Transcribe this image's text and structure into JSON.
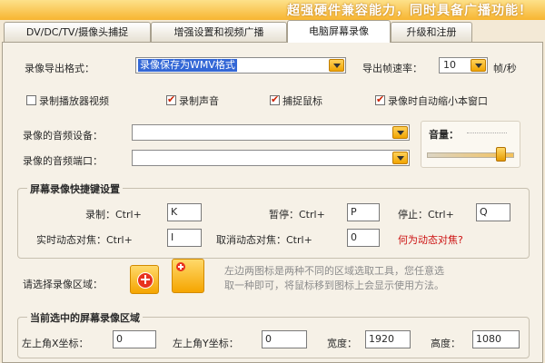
{
  "banner": {
    "text": "超强硬件兼容能力，同时具备广播功能！"
  },
  "tabs": [
    {
      "label": "DV/DC/TV/摄像头捕捉"
    },
    {
      "label": "增强设置和视频广播"
    },
    {
      "label": "电脑屏幕录像"
    },
    {
      "label": "升级和注册"
    }
  ],
  "record_format": {
    "label": "录像导出格式：",
    "value": "录像保存为WMV格式"
  },
  "framerate": {
    "label": "导出帧速率：",
    "value": "10",
    "unit": "帧/秒"
  },
  "checkboxes": [
    {
      "label": "录制播放器视频",
      "checked": false
    },
    {
      "label": "录制声音",
      "checked": true
    },
    {
      "label": "捕捉鼠标",
      "checked": true
    },
    {
      "label": "录像时自动缩小本窗口",
      "checked": true
    }
  ],
  "audio_device": {
    "label": "录像的音频设备：",
    "value": ""
  },
  "audio_port": {
    "label": "录像的音频端口：",
    "value": ""
  },
  "volume": {
    "label": "音量：",
    "level": 0.85
  },
  "hotkeys": {
    "title": "屏幕录像快捷键设置",
    "record": {
      "label": "录制：Ctrl+",
      "value": "K"
    },
    "pause": {
      "label": "暂停：Ctrl+",
      "value": "P"
    },
    "stop": {
      "label": "停止：Ctrl+",
      "value": "Q"
    },
    "focus": {
      "label": "实时动态对焦：Ctrl+",
      "value": "I"
    },
    "cancel_focus": {
      "label": "取消动态对焦：Ctrl+",
      "value": "0"
    },
    "help_link": "何为动态对焦?"
  },
  "region": {
    "label": "请选择录像区域：",
    "hint_line1": "左边两图标是两种不同的区域选取工具，您任意选",
    "hint_line2": "取一种即可，将鼠标移到图标上会显示使用方法。"
  },
  "current_region": {
    "title": "当前选中的屏幕录像区域",
    "x": {
      "label": "左上角X坐标：",
      "value": "0"
    },
    "y": {
      "label": "左上角Y坐标：",
      "value": "0"
    },
    "width": {
      "label": "宽度：",
      "value": "1920"
    },
    "height": {
      "label": "高度：",
      "value": "1080"
    }
  },
  "colors": {
    "accent": "#f5a500",
    "link": "#cc1111",
    "selection": "#3367d6"
  }
}
